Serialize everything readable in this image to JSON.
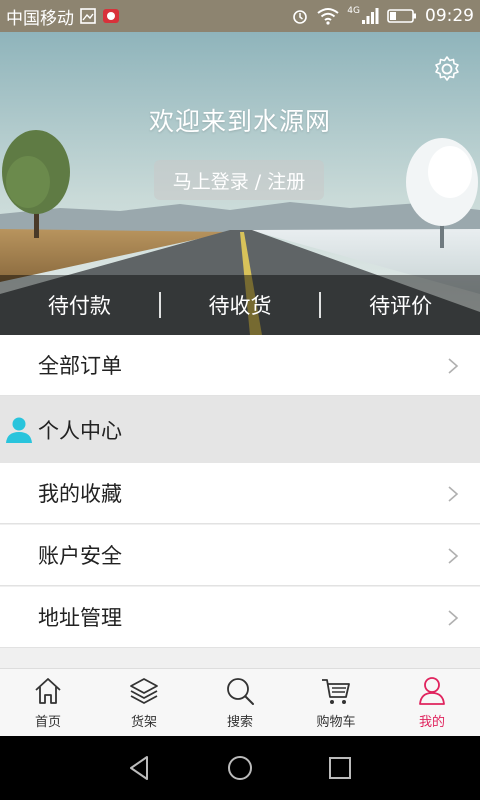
{
  "status_bar": {
    "carrier": "中国移动",
    "network": "4G",
    "time": "09:29"
  },
  "header": {
    "welcome": "欢迎来到水源网",
    "login_button": "马上登录 / 注册",
    "settings_icon": "gear-icon"
  },
  "order_tabs": [
    {
      "label": "待付款"
    },
    {
      "label": "待收货"
    },
    {
      "label": "待评价"
    }
  ],
  "menu": {
    "all_orders": "全部订单",
    "section_title": "个人中心",
    "items": [
      {
        "label": "我的收藏"
      },
      {
        "label": "账户安全"
      },
      {
        "label": "地址管理"
      }
    ]
  },
  "bottom_nav": [
    {
      "label": "首页",
      "icon": "home-icon"
    },
    {
      "label": "货架",
      "icon": "layers-icon"
    },
    {
      "label": "搜索",
      "icon": "search-icon"
    },
    {
      "label": "购物车",
      "icon": "cart-icon"
    },
    {
      "label": "我的",
      "icon": "user-icon",
      "active": true
    }
  ],
  "colors": {
    "accent": "#e0245e",
    "section_icon": "#29c4dc",
    "status_bar": "#8d8470"
  }
}
